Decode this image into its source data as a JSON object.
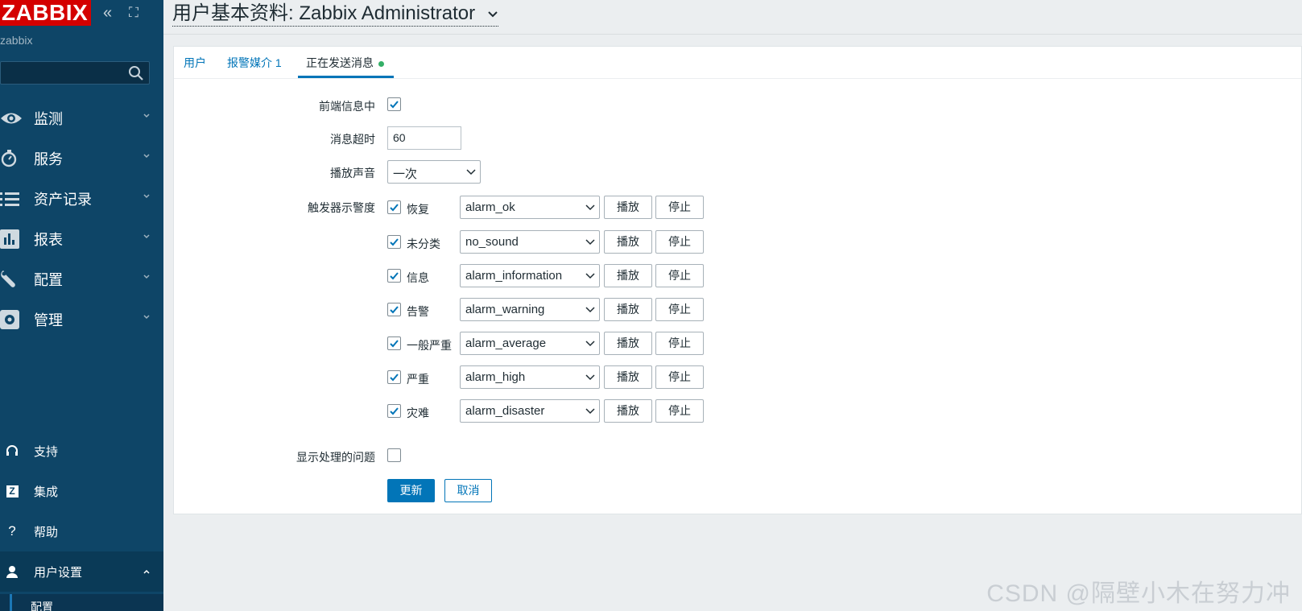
{
  "sidebar": {
    "logo": "ZABBIX",
    "collapse_icon": "«",
    "kiosk_icon": "⛶",
    "server_name": "zabbix",
    "search_placeholder": "",
    "menu": [
      {
        "label": "监测",
        "icon": "eye-icon"
      },
      {
        "label": "服务",
        "icon": "stopwatch-icon"
      },
      {
        "label": "资产记录",
        "icon": "list-icon"
      },
      {
        "label": "报表",
        "icon": "bar-chart-icon"
      },
      {
        "label": "配置",
        "icon": "wrench-icon"
      },
      {
        "label": "管理",
        "icon": "gear-icon"
      }
    ],
    "bottom": {
      "support": "支持",
      "integrations": "集成",
      "help": "帮助",
      "user_settings": "用户设置",
      "config": "配置",
      "help_icon_glyph": "?",
      "integrations_icon_glyph": "Z"
    }
  },
  "page": {
    "title": "用户基本资料: Zabbix Administrator"
  },
  "tabs": {
    "user": "用户",
    "media": "报警媒介",
    "media_count": "1",
    "messaging": "正在发送消息"
  },
  "form": {
    "frontend_messaging_label": "前端信息中",
    "frontend_messaging_checked": true,
    "timeout_label": "消息超时",
    "timeout_value": "60",
    "play_sound_label": "播放声音",
    "play_sound_value": "一次",
    "trigger_severity_label": "触发器示警度",
    "severities": [
      {
        "name": "恢复",
        "sound": "alarm_ok",
        "checked": true
      },
      {
        "name": "未分类",
        "sound": "no_sound",
        "checked": true
      },
      {
        "name": "信息",
        "sound": "alarm_information",
        "checked": true
      },
      {
        "name": "告警",
        "sound": "alarm_warning",
        "checked": true
      },
      {
        "name": "一般严重",
        "sound": "alarm_average",
        "checked": true
      },
      {
        "name": "严重",
        "sound": "alarm_high",
        "checked": true
      },
      {
        "name": "灾难",
        "sound": "alarm_disaster",
        "checked": true
      }
    ],
    "play_button": "播放",
    "stop_button": "停止",
    "show_suppressed_label": "显示处理的问题",
    "show_suppressed_checked": false,
    "update_button": "更新",
    "cancel_button": "取消"
  },
  "watermark": "CSDN @隔壁小木在努力冲",
  "colors": {
    "sidebar_bg": "#0e4567",
    "logo_bg": "#d40000",
    "accent": "#0275b8",
    "dot": "#34af67"
  }
}
